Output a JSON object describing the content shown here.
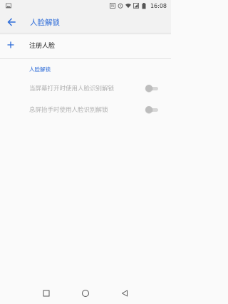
{
  "status_bar": {
    "time": "16:08",
    "icons": [
      "image-icon",
      "nfc-icon",
      "alarm-icon",
      "wifi-icon",
      "signal-icon",
      "battery-icon"
    ]
  },
  "app_bar": {
    "back_icon": "back-arrow-icon",
    "title": "人脸解锁"
  },
  "add_item": {
    "icon": "plus-icon",
    "label": "注册人脸"
  },
  "section": {
    "header": "人脸解锁",
    "items": [
      {
        "label": "当屏幕打开时使用人脸识别解锁",
        "enabled": false,
        "checked": false
      },
      {
        "label": "息屏抬手时使用人脸识别解锁",
        "enabled": false,
        "checked": false
      }
    ]
  },
  "nav_bar": {
    "buttons": [
      "recents-square-icon",
      "home-circle-icon",
      "back-triangle-icon"
    ]
  },
  "colors": {
    "accent": "#2b6ad8",
    "disabled_text": "#b0b0b0",
    "background": "#fafafa"
  }
}
